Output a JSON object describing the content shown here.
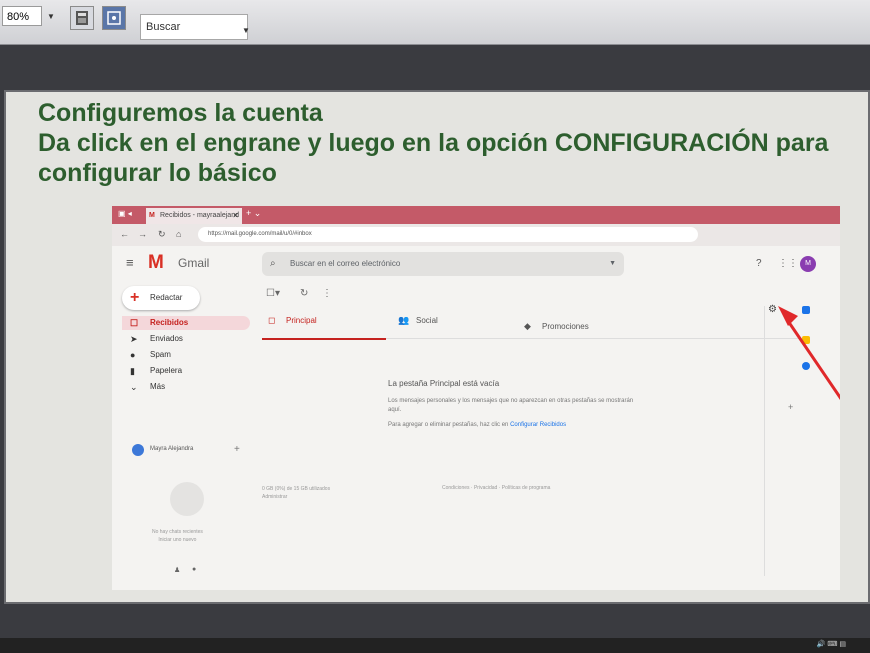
{
  "toolbar": {
    "zoom_value": "80%",
    "search_placeholder": "Buscar"
  },
  "slide": {
    "title_line1": "Configuremos la cuenta",
    "title_line2": "Da click en el engrane y luego en la opción CONFIGURACIÓN para",
    "title_line3": "configurar lo básico",
    "title_color": "#2d5e2e"
  },
  "gmail": {
    "tab_title": "Recibidos - mayraalejand",
    "url": "https://mail.google.com/mail/u/0/#inbox",
    "brand": "Gmail",
    "search_placeholder": "Buscar en el correo electrónico",
    "avatar_letter": "M",
    "compose_label": "Redactar",
    "nav": [
      {
        "label": "Recibidos",
        "icon": "inbox-icon",
        "selected": true
      },
      {
        "label": "Enviados",
        "icon": "send-icon",
        "selected": false
      },
      {
        "label": "Spam",
        "icon": "spam-icon",
        "selected": false
      },
      {
        "label": "Papelera",
        "icon": "trash-icon",
        "selected": false
      },
      {
        "label": "Más",
        "icon": "chevron-down-icon",
        "selected": false
      }
    ],
    "tabs": [
      {
        "label": "Principal",
        "selected": true
      },
      {
        "label": "Social",
        "selected": false
      },
      {
        "label": "Promociones",
        "selected": false
      }
    ],
    "empty_title": "La pestaña Principal está vacía",
    "empty_desc": "Los mensajes personales y los mensajes que no aparezcan en otras pestañas se mostrarán aquí.",
    "empty_hint": "Para agregar o eliminar pestañas, haz clic en",
    "empty_link": "Configurar Recibidos",
    "chat_user": "Mayra Alejandra",
    "storage": "0 GB (0%) de 15 GB utilizados",
    "admin": "Administrar",
    "terms": "Condiciones · Privacidad · Políticas de programa",
    "no_chats": "No hay chats recientes",
    "start_new": "Iniciar uno nuevo"
  },
  "colors": {
    "accent_red": "#d93025",
    "arrow_red": "#e0282a"
  }
}
